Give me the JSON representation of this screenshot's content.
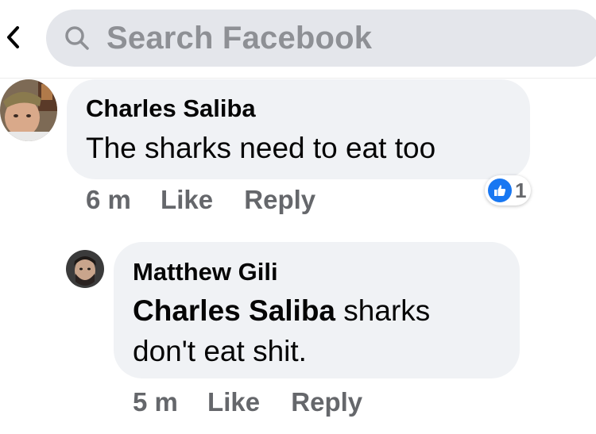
{
  "header": {
    "back_icon": "chevron-left-icon",
    "search": {
      "icon": "search-icon",
      "placeholder": "Search Facebook"
    }
  },
  "comments": [
    {
      "author": "Charles Saliba",
      "text": "The sharks need to eat too",
      "time": "6 m",
      "like_label": "Like",
      "reply_label": "Reply",
      "reaction": {
        "icon": "like-icon",
        "count": "1"
      }
    }
  ],
  "reply": {
    "author": "Matthew Gili",
    "mention": "Charles Saliba",
    "text_line1": " sharks",
    "text_line2": "don't eat shit.",
    "time": "5 m",
    "like_label": "Like",
    "reply_label": "Reply"
  },
  "colors": {
    "search_bg": "#e4e6eb",
    "bubble_bg": "#f0f2f5",
    "meta_text": "#65676b",
    "like_blue": "#1877f2"
  }
}
